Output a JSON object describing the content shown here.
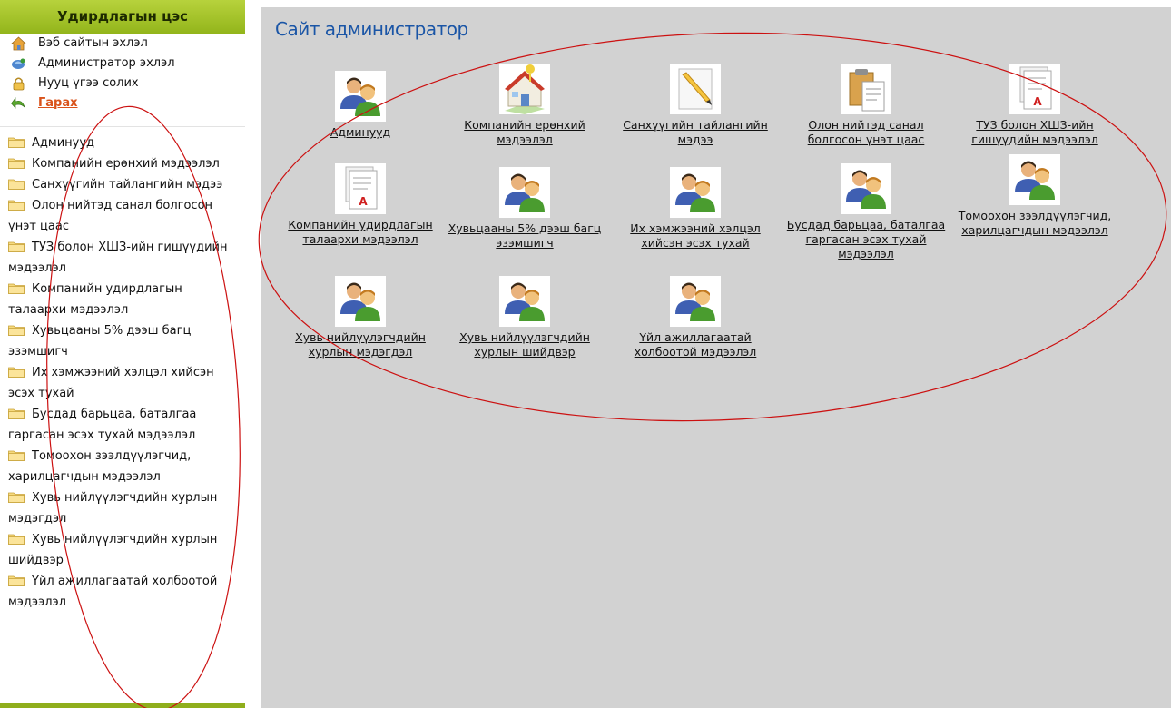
{
  "sidebar": {
    "title": "Удирдлагын цэс",
    "top_links": [
      {
        "label": "Вэб сайтын эхлэл",
        "icon": "home-icon"
      },
      {
        "label": "Администратор эхлэл",
        "icon": "admin-icon"
      },
      {
        "label": "Нууц үгээ солих",
        "icon": "lock-icon"
      },
      {
        "label": "Гарах",
        "icon": "exit-arrow-icon"
      }
    ],
    "folder_items": [
      "Админууд",
      "Компанийн ерөнхий мэдээлэл",
      "Санхүүгийн тайлангийн мэдээ",
      "Олон нийтэд санал болгосон үнэт цаас",
      "ТУЗ болон ХШЗ-ийн гишүүдийн мэдээлэл",
      "Компанийн удирдлагын талаархи мэдээлэл",
      "Хувьцааны 5% дээш багц эзэмшигч",
      "Их хэмжээний хэлцэл хийсэн эсэх тухай",
      "Бусдад барьцаа, баталгаа гаргасан эсэх тухай мэдээлэл",
      "Томоохон зээлдүүлэгчид, харилцагчдын мэдээлэл",
      "Хувь нийлүүлэгчдийн хурлын мэдэгдэл",
      "Хувь нийлүүлэгчдийн хурлын шийдвэр",
      "Үйл ажиллагаатай холбоотой мэдээлэл"
    ]
  },
  "main": {
    "title": "Сайт администратор",
    "tiles": [
      {
        "label": "Админууд",
        "icon": "users-icon"
      },
      {
        "label": "Компанийн ерөнхий мэдээлэл",
        "icon": "house-icon"
      },
      {
        "label": "Санхүүгийн тайлангийн мэдээ",
        "icon": "edit-pencil-icon"
      },
      {
        "label": "Олон нийтэд санал болгосон үнэт цаас",
        "icon": "clipboard-icon"
      },
      {
        "label": "ТУЗ болон ХШЗ-ийн гишүүдийн мэдээлэл",
        "icon": "pdf-document-icon"
      },
      {
        "label": "Компанийн удирдлагын талаархи мэдээлэл",
        "icon": "pdf-document-icon"
      },
      {
        "label": "Хувьцааны 5% дээш багц эзэмшигч",
        "icon": "users-icon"
      },
      {
        "label": "Их хэмжээний хэлцэл хийсэн эсэх тухай",
        "icon": "users-icon"
      },
      {
        "label": "Бусдад барьцаа, баталгаа гаргасан эсэх тухай мэдээлэл",
        "icon": "users-icon"
      },
      {
        "label": "Томоохон зээлдүүлэгчид, харилцагчдын мэдээлэл",
        "icon": "users-icon"
      },
      {
        "label": "Хувь нийлүүлэгчдийн хурлын мэдэгдэл",
        "icon": "users-icon"
      },
      {
        "label": "Хувь нийлүүлэгчдийн хурлын шийдвэр",
        "icon": "users-icon"
      },
      {
        "label": "Үйл ажиллагаатай холбоотой мэдээлэл",
        "icon": "users-icon"
      }
    ]
  },
  "colors": {
    "header_green": "#9bbd24",
    "title_blue": "#1a55a6",
    "exit_orange": "#d9531b",
    "annotation_red": "#cc1111",
    "panel_gray": "#d2d2d2"
  }
}
